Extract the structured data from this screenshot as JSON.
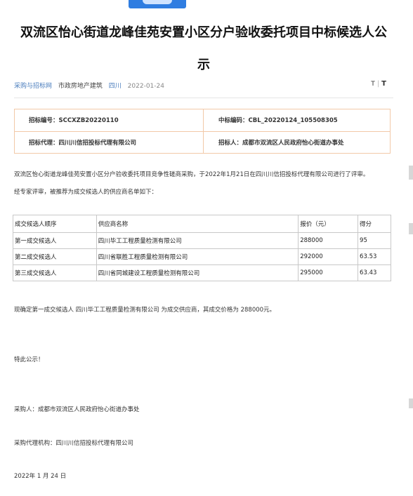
{
  "header": {
    "title_line1": "双流区怡心街道龙峰佳苑安置小区分户验收委托项目中标候选人公",
    "title_line2": "示"
  },
  "meta": {
    "source": "采购与招标网",
    "category": "市政房地产建筑",
    "region": "四川",
    "date": "2022-01-24",
    "font_small": "T",
    "font_large": "T"
  },
  "info_box": {
    "bid_no_label": "招标编号：",
    "bid_no_value": "SCCXZB20220110",
    "winning_code_label": "中标编码：",
    "winning_code_value": "CBL_20220124_105508305",
    "agent_label": "招标代理：",
    "agent_value": "四川川信招投标代理有限公司",
    "tenderer_label": "招标人：",
    "tenderer_value": "成都市双流区人民政府怡心街道办事处"
  },
  "body": {
    "intro": "双流区怡心街道龙峰佳苑安置小区分户验收委托项目竞争性磋商采购，于2022年1月21日在四川川信招投标代理有限公司进行了评审。",
    "intro2": "经专家评审，被推荐为成交候选人的供应商名单如下：",
    "conclusion": "现确定第一成交候选人    四川毕工工程质量检测有限公司 为成交供应商，其成交价格为 288000元。",
    "notice": "特此公示！",
    "purchaser": "采购人：成都市双流区人民政府怡心街道办事处",
    "agency": "采购代理机构：四川川信招投标代理有限公司",
    "date": "2022年 1 月 24 日"
  },
  "table": {
    "headers": [
      "成交候选人顺序",
      "供应商名称",
      "报价（元）",
      "得分"
    ],
    "rows": [
      [
        "第一成交候选人",
        "四川毕工工程质量检测有限公司",
        "288000",
        "95"
      ],
      [
        "第二成交候选人",
        "四川省联胜工程质量检测有限公司",
        "292000",
        "63.53"
      ],
      [
        "第三成交候选人",
        "四川省同城建设工程质量检测有限公司",
        "295000",
        "63.43"
      ]
    ]
  },
  "colors": {
    "box_border": "#f2c9a8",
    "link": "#4a7dbd",
    "logo_blue": "#2f7de1"
  }
}
